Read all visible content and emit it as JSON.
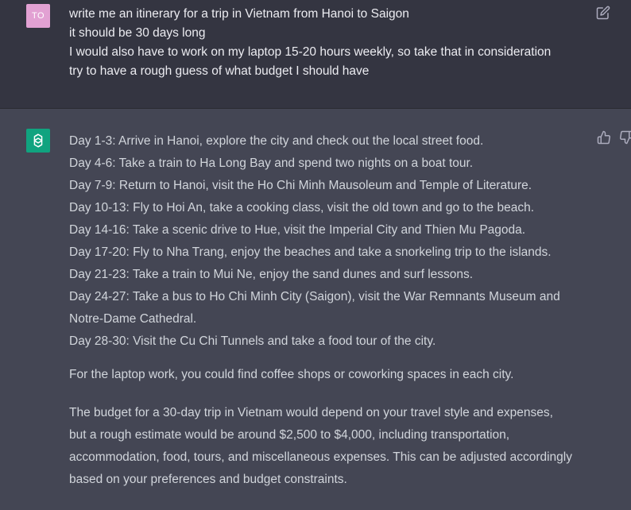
{
  "user_message": {
    "avatar_initials": "TO",
    "lines": [
      "write me an itinerary for a trip in Vietnam from Hanoi to Saigon",
      "it should be 30 days long",
      "I would also have to work on my laptop 15-20 hours weekly, so take that in consideration",
      "try to have a rough guess of what budget I should have"
    ]
  },
  "assistant_message": {
    "itinerary": [
      "Day 1-3: Arrive in Hanoi, explore the city and check out the local street food.",
      "Day 4-6: Take a train to Ha Long Bay and spend two nights on a boat tour.",
      "Day 7-9: Return to Hanoi, visit the Ho Chi Minh Mausoleum and Temple of Literature.",
      "Day 10-13: Fly to Hoi An, take a cooking class, visit the old town and go to the beach.",
      "Day 14-16: Take a scenic drive to Hue, visit the Imperial City and Thien Mu Pagoda.",
      "Day 17-20: Fly to Nha Trang, enjoy the beaches and take a snorkeling trip to the islands.",
      "Day 21-23: Take a train to Mui Ne, enjoy the sand dunes and surf lessons.",
      "Day 24-27: Take a bus to Ho Chi Minh City (Saigon), visit the War Remnants Museum and",
      "Notre-Dame Cathedral.",
      "Day 28-30: Visit the Cu Chi Tunnels and take a food tour of the city."
    ],
    "work_paragraph": "For the laptop work, you could find coffee shops or coworking spaces in each city.",
    "budget_lines": [
      "The budget for a 30-day trip in Vietnam would depend on your travel style and expenses,",
      "but a rough estimate would be around $2,500 to $4,000, including transportation,",
      "accommodation, food, tours, and miscellaneous expenses. This can be adjusted accordingly",
      "based on your preferences and budget constraints."
    ]
  },
  "icons": {
    "edit": "edit-icon",
    "assistant_avatar": "openai-logo-icon",
    "like": "thumbs-up-icon",
    "dislike": "thumbs-down-icon"
  },
  "colors": {
    "user_bg": "#343541",
    "assistant_bg": "#444654",
    "user_avatar": "#e2a1d3",
    "assistant_avatar": "#10a37f",
    "text": "#d1d5db"
  }
}
